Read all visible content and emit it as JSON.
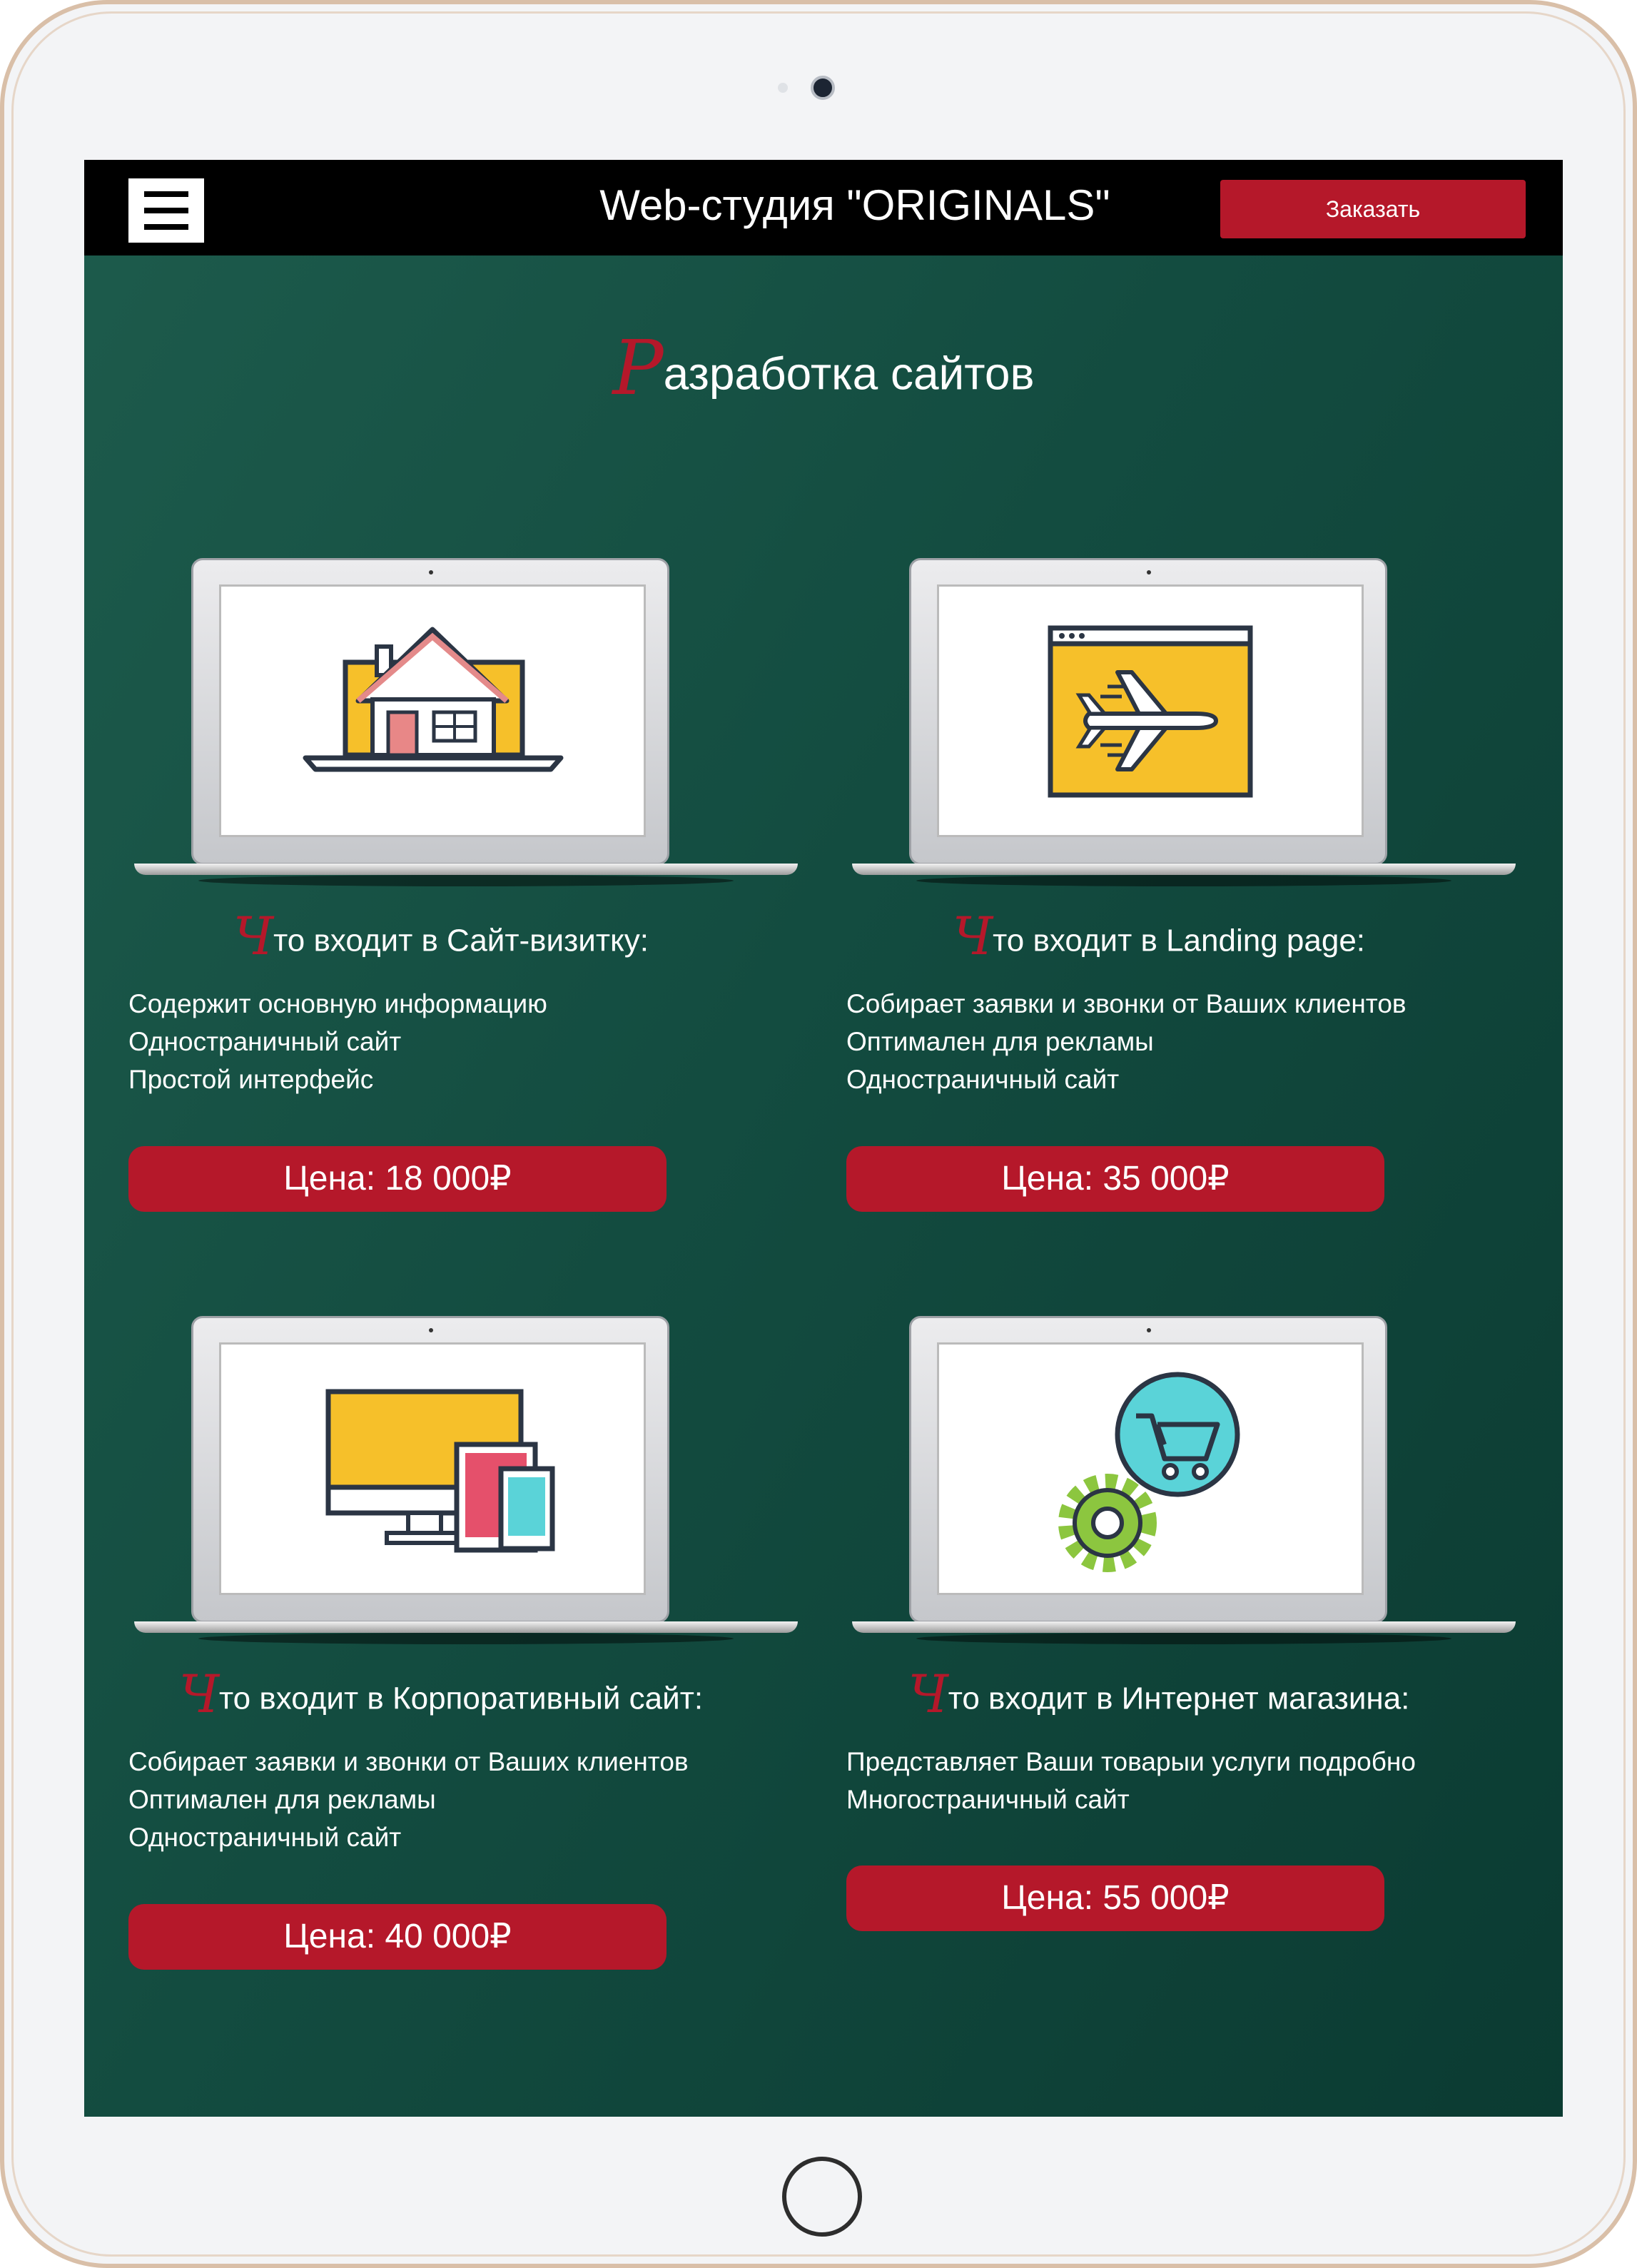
{
  "header": {
    "menu_icon": "hamburger-menu-icon",
    "title": "Web-студия \"ORIGINALS\"",
    "order_label": "Заказать"
  },
  "page": {
    "heading_initial": "Р",
    "heading_rest": "азработка сайтов"
  },
  "colors": {
    "accent": "#b5182a",
    "background_green": "#134c40",
    "header_black": "#000000"
  },
  "cards": [
    {
      "icon": "house-laptop-icon",
      "title_initial": "Ч",
      "title_rest": "то входит в Сайт-визитку:",
      "features": [
        "Содержит основную информацию",
        "Одностраничный сайт",
        "Простой интерфейс"
      ],
      "price": "Цена: 18 000₽"
    },
    {
      "icon": "airplane-window-icon",
      "title_initial": "Ч",
      "title_rest": "то входит в Landing page:",
      "features": [
        "Собирает заявки и звонки от Ваших клиентов",
        "Оптимален для рекламы",
        "Одностраничный сайт"
      ],
      "price": "Цена: 35 000₽"
    },
    {
      "icon": "multi-device-icon",
      "title_initial": "Ч",
      "title_rest": "то входит в Корпоративный сайт:",
      "features": [
        "Собирает заявки и звонки от Ваших клиентов",
        "Оптимален для рекламы",
        "Одностраничный сайт"
      ],
      "price": "Цена: 40 000₽"
    },
    {
      "icon": "shopping-cart-gear-icon",
      "title_initial": "Ч",
      "title_rest": "то входит в Интернет магазина:",
      "features": [
        "Представляет Ваши товарыи услуги подробно",
        "Многостраничный сайт"
      ],
      "price": "Цена: 55 000₽"
    }
  ]
}
